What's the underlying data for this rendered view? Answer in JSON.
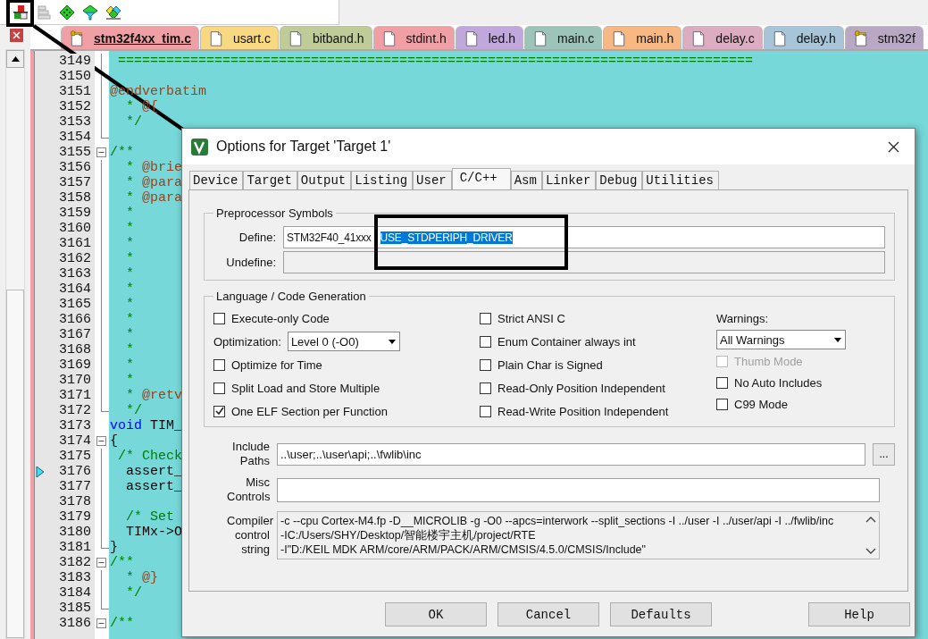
{
  "editor_tabs": [
    {
      "label": "stm32f4xx_tim.c",
      "kind": "key",
      "color": "#f0a0a4",
      "selected": true
    },
    {
      "label": "usart.c",
      "kind": "page",
      "color": "#f8d880",
      "selected": false
    },
    {
      "label": "bitband.h",
      "kind": "page",
      "color": "#c0cc98",
      "selected": false
    },
    {
      "label": "stdint.h",
      "kind": "page",
      "color": "#f0a0a4",
      "selected": false
    },
    {
      "label": "led.h",
      "kind": "page",
      "color": "#c0a8dc",
      "selected": false
    },
    {
      "label": "main.c",
      "kind": "page",
      "color": "#9cc4b8",
      "selected": false
    },
    {
      "label": "main.h",
      "kind": "page",
      "color": "#f8b884",
      "selected": false
    },
    {
      "label": "delay.c",
      "kind": "page",
      "color": "#dcacc0",
      "selected": false
    },
    {
      "label": "delay.h",
      "kind": "page",
      "color": "#a8c4d8",
      "selected": false
    },
    {
      "label": "stm32f",
      "kind": "key",
      "color": "#b8a8c4",
      "selected": false
    }
  ],
  "code_lines": [
    {
      "number": "3149",
      "in_fold": true,
      "fold_start": false,
      "fold_end": false,
      "marker": false,
      "tokens": [
        {
          "text": " ===============================================================================",
          "kind": "comment"
        }
      ]
    },
    {
      "number": "3150",
      "in_fold": true,
      "fold_start": false,
      "fold_end": false,
      "marker": false
    },
    {
      "number": "3151",
      "in_fold": true,
      "fold_start": false,
      "fold_end": false,
      "marker": false,
      "tokens": [
        {
          "text": "@endverbatim",
          "kind": "tag"
        }
      ]
    },
    {
      "number": "3152",
      "in_fold": true,
      "fold_start": false,
      "fold_end": false,
      "marker": false,
      "tokens": [
        {
          "text": "  * ",
          "kind": "comment"
        },
        {
          "text": "@{",
          "kind": "tag"
        }
      ]
    },
    {
      "number": "3153",
      "in_fold": true,
      "fold_start": false,
      "fold_end": false,
      "marker": false,
      "tokens": [
        {
          "text": "  */",
          "kind": "comment"
        }
      ]
    },
    {
      "number": "3154",
      "in_fold": true,
      "fold_start": false,
      "fold_end": true,
      "marker": false
    },
    {
      "number": "3155",
      "in_fold": true,
      "fold_start": true,
      "fold_end": false,
      "marker": false,
      "tokens": [
        {
          "text": "/**",
          "kind": "comment"
        }
      ]
    },
    {
      "number": "3156",
      "in_fold": true,
      "fold_start": false,
      "fold_end": false,
      "marker": false,
      "tokens": [
        {
          "text": "  * ",
          "kind": "comment"
        },
        {
          "text": "@brie",
          "kind": "tag"
        }
      ]
    },
    {
      "number": "3157",
      "in_fold": true,
      "fold_start": false,
      "fold_end": false,
      "marker": false,
      "tokens": [
        {
          "text": "  * ",
          "kind": "comment"
        },
        {
          "text": "@para",
          "kind": "tag"
        }
      ]
    },
    {
      "number": "3158",
      "in_fold": true,
      "fold_start": false,
      "fold_end": false,
      "marker": false,
      "tokens": [
        {
          "text": "  * ",
          "kind": "comment"
        },
        {
          "text": "@para",
          "kind": "tag"
        }
      ]
    },
    {
      "number": "3159",
      "in_fold": true,
      "fold_start": false,
      "fold_end": false,
      "marker": false,
      "tokens": [
        {
          "text": "  *",
          "kind": "comment"
        }
      ]
    },
    {
      "number": "3160",
      "in_fold": true,
      "fold_start": false,
      "fold_end": false,
      "marker": false,
      "tokens": [
        {
          "text": "  *",
          "kind": "comment"
        }
      ]
    },
    {
      "number": "3161",
      "in_fold": true,
      "fold_start": false,
      "fold_end": false,
      "marker": false,
      "tokens": [
        {
          "text": "  *",
          "kind": "comment"
        }
      ]
    },
    {
      "number": "3162",
      "in_fold": true,
      "fold_start": false,
      "fold_end": false,
      "marker": false,
      "tokens": [
        {
          "text": "  *",
          "kind": "comment"
        }
      ]
    },
    {
      "number": "3163",
      "in_fold": true,
      "fold_start": false,
      "fold_end": false,
      "marker": false,
      "tokens": [
        {
          "text": "  *",
          "kind": "comment"
        }
      ]
    },
    {
      "number": "3164",
      "in_fold": true,
      "fold_start": false,
      "fold_end": false,
      "marker": false,
      "tokens": [
        {
          "text": "  *",
          "kind": "comment"
        }
      ]
    },
    {
      "number": "3165",
      "in_fold": true,
      "fold_start": false,
      "fold_end": false,
      "marker": false,
      "tokens": [
        {
          "text": "  *",
          "kind": "comment"
        }
      ]
    },
    {
      "number": "3166",
      "in_fold": true,
      "fold_start": false,
      "fold_end": false,
      "marker": false,
      "tokens": [
        {
          "text": "  *",
          "kind": "comment"
        }
      ]
    },
    {
      "number": "3167",
      "in_fold": true,
      "fold_start": false,
      "fold_end": false,
      "marker": false,
      "tokens": [
        {
          "text": "  *",
          "kind": "comment"
        }
      ]
    },
    {
      "number": "3168",
      "in_fold": true,
      "fold_start": false,
      "fold_end": false,
      "marker": false,
      "tokens": [
        {
          "text": "  *",
          "kind": "comment"
        }
      ]
    },
    {
      "number": "3169",
      "in_fold": true,
      "fold_start": false,
      "fold_end": false,
      "marker": false,
      "tokens": [
        {
          "text": "  *",
          "kind": "comment"
        }
      ]
    },
    {
      "number": "3170",
      "in_fold": true,
      "fold_start": false,
      "fold_end": false,
      "marker": false,
      "tokens": [
        {
          "text": "  *",
          "kind": "comment"
        }
      ]
    },
    {
      "number": "3171",
      "in_fold": true,
      "fold_start": false,
      "fold_end": false,
      "marker": false,
      "tokens": [
        {
          "text": "  * ",
          "kind": "comment"
        },
        {
          "text": "@retv",
          "kind": "tag"
        }
      ]
    },
    {
      "number": "3172",
      "in_fold": true,
      "fold_start": false,
      "fold_end": true,
      "marker": false,
      "tokens": [
        {
          "text": "  */",
          "kind": "comment"
        }
      ]
    },
    {
      "number": "3173",
      "in_fold": false,
      "fold_start": false,
      "fold_end": false,
      "marker": false,
      "tokens": [
        {
          "text": "void",
          "kind": "keyword"
        },
        {
          "text": " TIM_",
          "kind": "plain"
        }
      ]
    },
    {
      "number": "3174",
      "in_fold": true,
      "fold_start": true,
      "fold_end": false,
      "marker": false,
      "tokens": [
        {
          "text": "{",
          "kind": "plain"
        }
      ]
    },
    {
      "number": "3175",
      "in_fold": true,
      "fold_start": false,
      "fold_end": false,
      "marker": false,
      "tokens": [
        {
          "text": " /* Check",
          "kind": "comment"
        }
      ]
    },
    {
      "number": "3176",
      "in_fold": true,
      "fold_start": false,
      "fold_end": false,
      "marker": true,
      "tokens": [
        {
          "text": "  assert_",
          "kind": "plain"
        }
      ]
    },
    {
      "number": "3177",
      "in_fold": true,
      "fold_start": false,
      "fold_end": false,
      "marker": false,
      "tokens": [
        {
          "text": "  assert_",
          "kind": "plain"
        }
      ]
    },
    {
      "number": "3178",
      "in_fold": true,
      "fold_start": false,
      "fold_end": false,
      "marker": false
    },
    {
      "number": "3179",
      "in_fold": true,
      "fold_start": false,
      "fold_end": false,
      "marker": false,
      "tokens": [
        {
          "text": "  /* Set",
          "kind": "comment"
        }
      ]
    },
    {
      "number": "3180",
      "in_fold": true,
      "fold_start": false,
      "fold_end": false,
      "marker": false,
      "tokens": [
        {
          "text": "  TIMx->O",
          "kind": "plain"
        }
      ]
    },
    {
      "number": "3181",
      "in_fold": true,
      "fold_start": false,
      "fold_end": true,
      "marker": false,
      "tokens": [
        {
          "text": "}",
          "kind": "plain"
        }
      ]
    },
    {
      "number": "3182",
      "in_fold": true,
      "fold_start": true,
      "fold_end": false,
      "marker": false,
      "tokens": [
        {
          "text": "/**",
          "kind": "comment"
        }
      ]
    },
    {
      "number": "3183",
      "in_fold": true,
      "fold_start": false,
      "fold_end": false,
      "marker": false,
      "tokens": [
        {
          "text": "  * ",
          "kind": "comment"
        },
        {
          "text": "@}",
          "kind": "tag"
        }
      ]
    },
    {
      "number": "3184",
      "in_fold": true,
      "fold_start": false,
      "fold_end": false,
      "marker": false,
      "tokens": [
        {
          "text": "  */",
          "kind": "comment"
        }
      ]
    },
    {
      "number": "3185",
      "in_fold": true,
      "fold_start": false,
      "fold_end": true,
      "marker": false
    },
    {
      "number": "3186",
      "in_fold": true,
      "fold_start": true,
      "fold_end": false,
      "marker": false,
      "tokens": [
        {
          "text": "/**",
          "kind": "comment"
        }
      ]
    }
  ],
  "dialog": {
    "title": "Options for Target 'Target 1'",
    "tabs": [
      {
        "label": "Device",
        "selected": false
      },
      {
        "label": "Target",
        "selected": false
      },
      {
        "label": "Output",
        "selected": false
      },
      {
        "label": "Listing",
        "selected": false
      },
      {
        "label": "User",
        "selected": false
      },
      {
        "label": "C/C++",
        "selected": true
      },
      {
        "label": "Asm",
        "selected": false
      },
      {
        "label": "Linker",
        "selected": false
      },
      {
        "label": "Debug",
        "selected": false
      },
      {
        "label": "Utilities",
        "selected": false
      }
    ],
    "preprocessor": {
      "title": "Preprocessor Symbols",
      "define_label": "Define:",
      "define_value": "STM32F40_41xxx",
      "define_selected": "USE_STDPERIPH_DRIVER",
      "undefine_label": "Undefine:"
    },
    "language": {
      "title": "Language / Code Generation",
      "column_1": [
        {
          "kind": "checkbox",
          "label": "Execute-only Code",
          "checked": false,
          "disabled": false
        },
        {
          "kind": "dropdown",
          "label": "Optimization:",
          "value": "Level 0 (-O0)"
        },
        {
          "kind": "checkbox",
          "label": "Optimize for Time",
          "checked": false,
          "disabled": false
        },
        {
          "kind": "checkbox",
          "label": "Split Load and Store Multiple",
          "checked": false,
          "disabled": false
        },
        {
          "kind": "checkbox",
          "label": "One ELF Section per Function",
          "checked": true,
          "disabled": false
        }
      ],
      "column_2": [
        {
          "kind": "checkbox",
          "label": "Strict ANSI C",
          "checked": false,
          "disabled": false
        },
        {
          "kind": "checkbox",
          "label": "Enum Container always int",
          "checked": false,
          "disabled": false
        },
        {
          "kind": "checkbox",
          "label": "Plain Char is Signed",
          "checked": false,
          "disabled": false
        },
        {
          "kind": "checkbox",
          "label": "Read-Only Position Independent",
          "checked": false,
          "disabled": false
        },
        {
          "kind": "checkbox",
          "label": "Read-Write Position Independent",
          "checked": false,
          "disabled": false
        }
      ],
      "column_3": [
        {
          "kind": "label",
          "label": "Warnings:"
        },
        {
          "kind": "dropdown",
          "value": "All Warnings"
        },
        {
          "kind": "checkbox",
          "label": "Thumb Mode",
          "checked": false,
          "disabled": true
        },
        {
          "kind": "checkbox",
          "label": "No Auto Includes",
          "checked": false,
          "disabled": false
        },
        {
          "kind": "checkbox",
          "label": "C99 Mode",
          "checked": false,
          "disabled": false
        }
      ]
    },
    "include_label": [
      "Include",
      "Paths"
    ],
    "include_value": "..\\user;..\\user\\api;..\\fwlib\\inc",
    "browse_button": "...",
    "misc_label": [
      "Misc",
      "Controls"
    ],
    "compiler_label": [
      "Compiler",
      "control",
      "string"
    ],
    "compiler_lines": [
      "-c --cpu Cortex-M4.fp -D__MICROLIB -g -O0 --apcs=interwork --split_sections -I ../user -I ../user/api -I ../fwlib/inc",
      "-IC:/Users/SHY/Desktop/智能楼宇主机/project/RTE",
      "-I\"D:/KEIL MDK ARM/core/ARM/PACK/ARM/CMSIS/4.5.0/CMSIS/Include\""
    ],
    "buttons": [
      {
        "label": "OK",
        "kind": "main"
      },
      {
        "label": "Cancel",
        "kind": "main"
      },
      {
        "label": "Defaults",
        "kind": "main"
      },
      {
        "label": "Help",
        "kind": "help"
      }
    ]
  }
}
